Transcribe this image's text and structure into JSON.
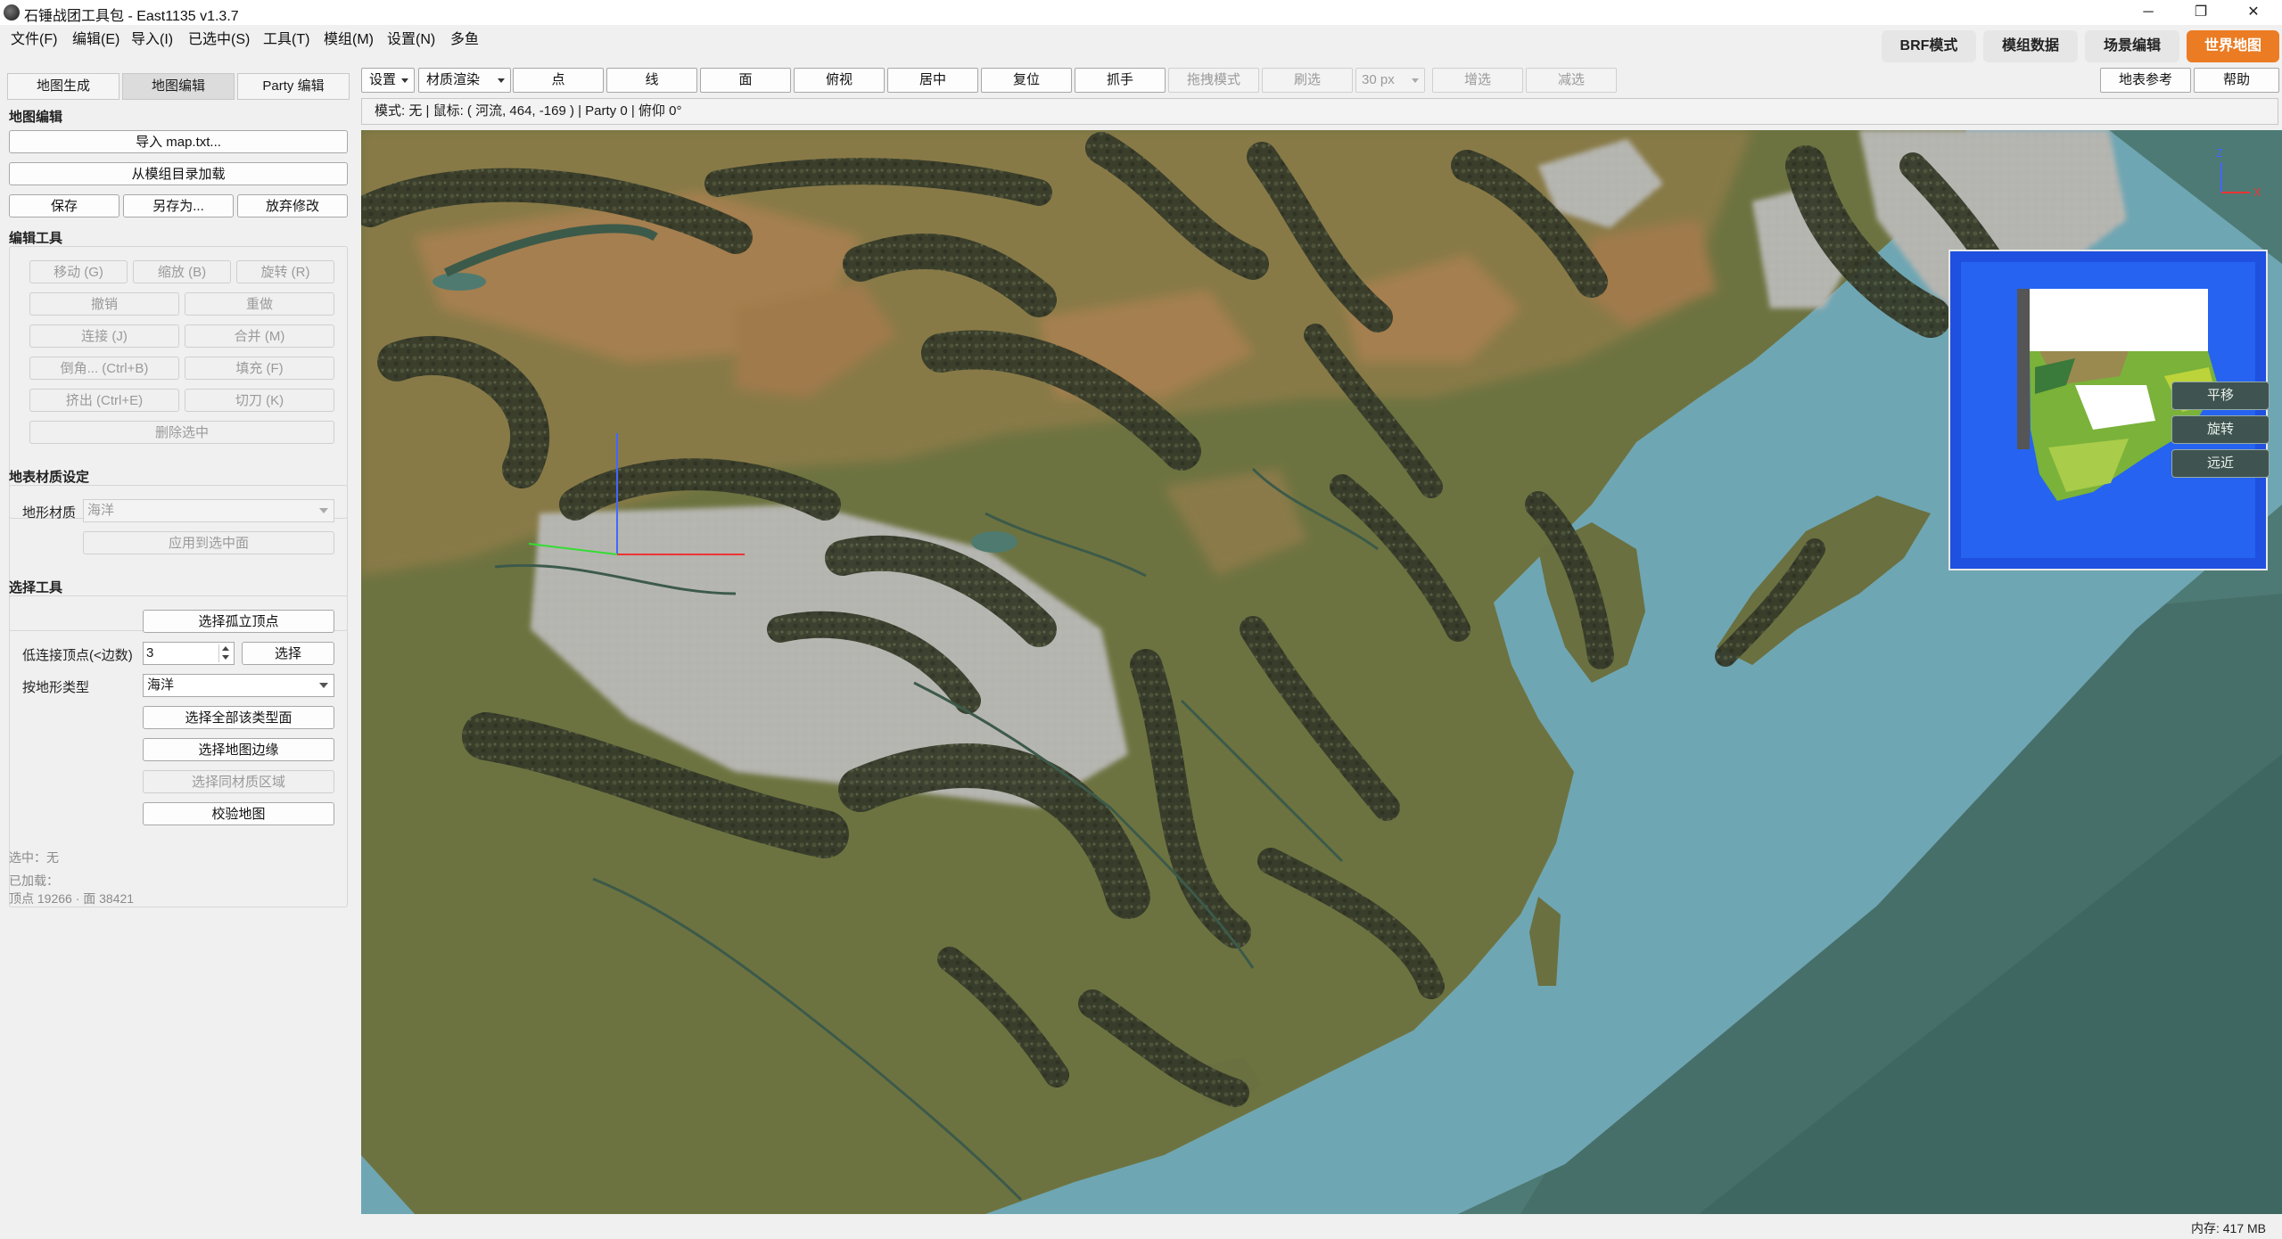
{
  "window": {
    "title": "石锤战团工具包 - East1135 v1.3.7",
    "controls": {
      "minimize": "─",
      "maximize": "❐",
      "close": "✕"
    }
  },
  "menu": [
    "文件(F)",
    "编辑(E)",
    "导入(I)",
    "已选中(S)",
    "工具(T)",
    "模组(M)",
    "设置(N)",
    "多鱼"
  ],
  "modes": {
    "brf": "BRF模式",
    "module_data": "模组数据",
    "scene_edit": "场景编辑",
    "world_map": "世界地图",
    "active": "world_map",
    "accent_color": "#ec7c23"
  },
  "left_tabs": {
    "generate": "地图生成",
    "edit": "地图编辑",
    "party": "Party 编辑",
    "active": "edit"
  },
  "map_edit": {
    "section": "地图编辑",
    "import": "导入 map.txt...",
    "load_from_module": "从模组目录加载",
    "save": "保存",
    "save_as": "另存为...",
    "discard": "放弃修改"
  },
  "edit_tools": {
    "section": "编辑工具",
    "move": "移动 (G)",
    "scale": "缩放 (B)",
    "rotate": "旋转 (R)",
    "undo": "撤销",
    "redo": "重做",
    "connect": "连接 (J)",
    "merge": "合并 (M)",
    "bevel": "倒角... (Ctrl+B)",
    "fill": "填充 (F)",
    "extrude": "挤出 (Ctrl+E)",
    "knife": "切刀 (K)",
    "delete": "删除选中"
  },
  "surface": {
    "section": "地表材质设定",
    "terrain_label": "地形材质",
    "terrain_value": "海洋",
    "apply": "应用到选中面"
  },
  "select_tools": {
    "section": "选择工具",
    "isolated": "选择孤立顶点",
    "low_connect_label": "低连接顶点(<边数)",
    "low_connect_value": "3",
    "select": "选择",
    "by_type_label": "按地形类型",
    "by_type_value": "海洋",
    "select_all_type": "选择全部该类型面",
    "select_border": "选择地图边缘",
    "select_same_region": "选择同材质区域",
    "validate": "校验地图"
  },
  "info": {
    "selected": "选中：无",
    "loaded": "已加载：",
    "counts": "顶点 19266 · 面 38421"
  },
  "toolbar": {
    "settings": "设置",
    "material_render": "材质渲染",
    "point": "点",
    "line": "线",
    "face": "面",
    "top_view": "俯视",
    "center": "居中",
    "reset": "复位",
    "grab": "抓手",
    "drag_mode": "拖拽模式",
    "brush_select": "刷选",
    "brush_size": "30 px",
    "add_select": "增选",
    "subtract_select": "减选",
    "surface_ref": "地表参考",
    "help": "帮助"
  },
  "status": "模式: 无  |  鼠标: ( 河流, 464, -169 )  |  Party 0  |  俯仰 0°",
  "viewport": {
    "axis_x": "X",
    "axis_z": "Z",
    "pan": "平移",
    "rotate": "旋转",
    "zoom": "远近",
    "colors": {
      "sea_deep": "#4d7a74",
      "sea_shallow": "#6fa6b3",
      "plains": "#6d7340",
      "steppe": "#887a46",
      "desert": "#a57f4f",
      "forest": "#3a3f2c",
      "snow": "#b9b9b4"
    }
  },
  "memory": "内存: 417 MB"
}
